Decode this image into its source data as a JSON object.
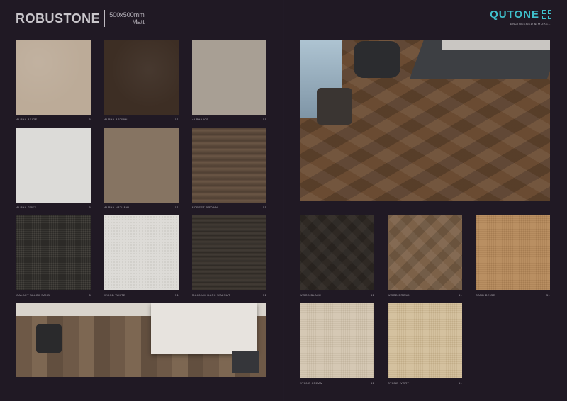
{
  "header": {
    "brand": "ROBUSTONE",
    "size": "500x500mm",
    "finish": "Matt",
    "logo_name": "QUTONE",
    "logo_tagline": "ENGINEERED & MORE..."
  },
  "left_tiles": [
    {
      "code": "ALPHA BEIGE",
      "num": "5"
    },
    {
      "code": "ALPHA BROWN",
      "num": "51"
    },
    {
      "code": "ALPHA ICE",
      "num": "51"
    },
    {
      "code": "ALPHA GREY",
      "num": "5"
    },
    {
      "code": "ALPHA NATURAL",
      "num": "51"
    },
    {
      "code": "FOREST BROWN",
      "num": "51"
    },
    {
      "code": "GALAXY BLACK SAND",
      "num": "5"
    },
    {
      "code": "WOOD WHITE",
      "num": "51"
    },
    {
      "code": "MAGNUM DARK WALNUT",
      "num": "51"
    }
  ],
  "right_tiles": [
    {
      "code": "WOOD BLACK",
      "num": "51"
    },
    {
      "code": "WOOD BROWN",
      "num": "51"
    },
    {
      "code": "SAND BEIGE",
      "num": "51"
    },
    {
      "code": "STONE CREAM",
      "num": "51"
    },
    {
      "code": "STONE IVORY",
      "num": "51"
    }
  ]
}
